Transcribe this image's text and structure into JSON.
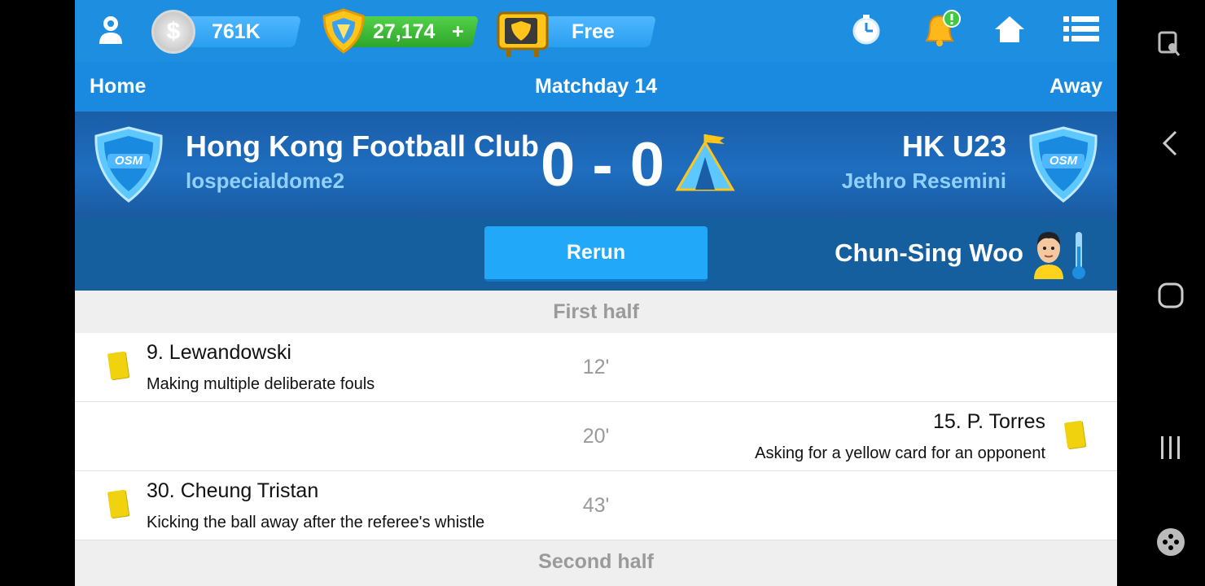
{
  "topbar": {
    "coins": "761K",
    "tokens": "27,174",
    "tokens_add": "+",
    "tv": "Free"
  },
  "subheader": {
    "home": "Home",
    "matchday": "Matchday 14",
    "away": "Away"
  },
  "match": {
    "home_team": "Hong Kong Football Club",
    "home_manager": "lospecialdome2",
    "score": "0 - 0",
    "away_team": "HK U23",
    "away_manager": "Jethro Resemini",
    "crest_text": "OSM"
  },
  "actions": {
    "rerun": "Rerun",
    "referee": "Chun-Sing Woo"
  },
  "events": {
    "first_half": "First half",
    "second_half": "Second half",
    "items": [
      {
        "side": "home",
        "player": "9. Lewandowski",
        "reason": "Making multiple deliberate fouls",
        "minute": "12'",
        "card": "yellow"
      },
      {
        "side": "away",
        "player": "15. P. Torres",
        "reason": "Asking for a yellow card for an opponent",
        "minute": "20'",
        "card": "yellow"
      },
      {
        "side": "home",
        "player": "30. Cheung Tristan",
        "reason": "Kicking the ball away after the referee's whistle",
        "minute": "43'",
        "card": "yellow"
      }
    ]
  },
  "colors": {
    "topbar": "#1e8fe0",
    "banner": "#1e6ec0",
    "action_row": "#155f9f",
    "rerun_button": "#22a8f8",
    "yellow_card": "#f1d20e"
  },
  "icons": [
    "profile-icon",
    "coin-icon",
    "token-shield-icon",
    "tv-icon",
    "stopwatch-icon",
    "bell-icon",
    "home-icon",
    "menu-icon",
    "osm-crest-icon",
    "tent-icon",
    "referee-avatar-icon",
    "thermometer-icon",
    "yellow-card-icon",
    "screenshot-icon",
    "back-icon",
    "android-home-icon",
    "recents-icon",
    "game-tools-icon"
  ]
}
